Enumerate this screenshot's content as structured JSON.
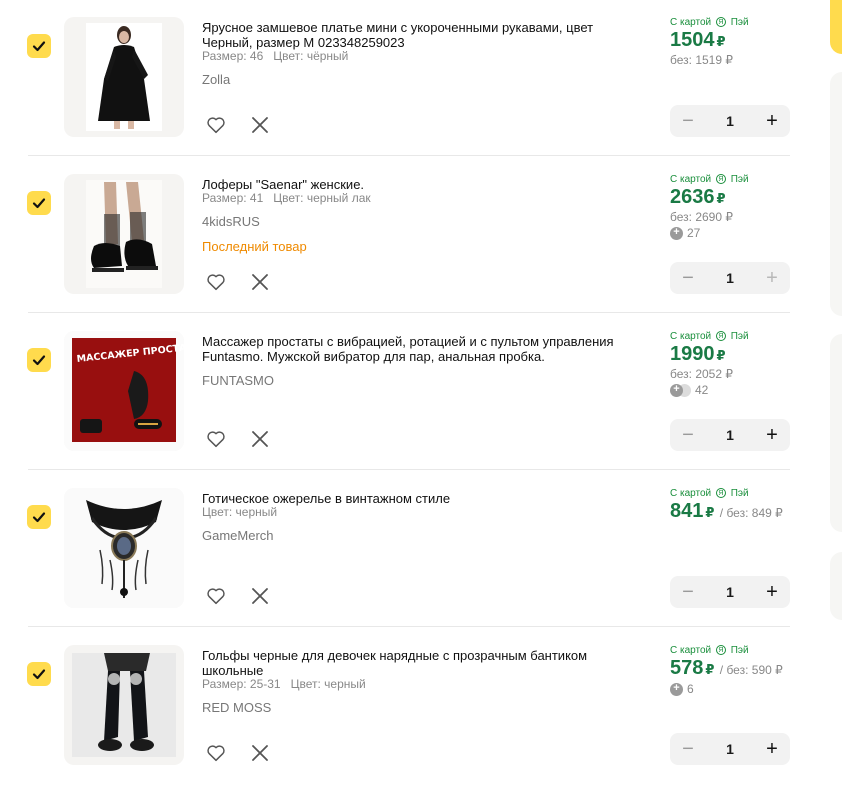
{
  "card_label": "С картой",
  "card_label_suffix": "Пэй",
  "card_logo_letter": "Я",
  "currency": "₽",
  "without_prefix": "без:",
  "items": [
    {
      "title": "Ярусное замшевое платье мини с укороченными рукавами, цвет Черный, размер M 023348259023",
      "size": "Размер: 46",
      "color": "Цвет: чёрный",
      "brand": "Zolla",
      "price": "1504",
      "old_price": "1519",
      "quantity": "1"
    },
    {
      "title": "Лоферы \"Saenar\" женские.",
      "size": "Размер: 41",
      "color": "Цвет: черный лак",
      "brand": "4kidsRUS",
      "last_item": "Последний товар",
      "price": "2636",
      "old_price": "2690",
      "bonus": "27",
      "quantity": "1"
    },
    {
      "title": "Массажер простаты с вибрацией, ротацией и с пультом управления Funtasmo. Мужской вибратор для пар, анальная пробка.",
      "brand": "FUNTASMO",
      "image_text": "МАССАЖЕР ПРОСТАТЫ",
      "price": "1990",
      "old_price": "2052",
      "bonus": "42",
      "quantity": "1"
    },
    {
      "title": "Готическое ожерелье в винтажном стиле",
      "color": "Цвет: черный",
      "brand": "GameMerch",
      "price": "841",
      "old_price": "849",
      "quantity": "1"
    },
    {
      "title": "Гольфы черные для девочек нарядные с прозрачным бантиком школьные",
      "size": "Размер: 25-31",
      "color": "Цвет: черный",
      "brand": "RED MOSS",
      "price": "578",
      "old_price": "590",
      "bonus": "6",
      "quantity": "1"
    }
  ],
  "icons": {
    "check": "checkmark-icon",
    "favorite": "heart-icon",
    "delete": "close-icon",
    "minus": "minus-icon",
    "plus": "plus-icon",
    "bonus": "plus-coin-icon"
  },
  "colors": {
    "accent_yellow": "#ffdb4d",
    "price_green": "#1a7a45",
    "last_item_orange": "#ef8a00"
  }
}
